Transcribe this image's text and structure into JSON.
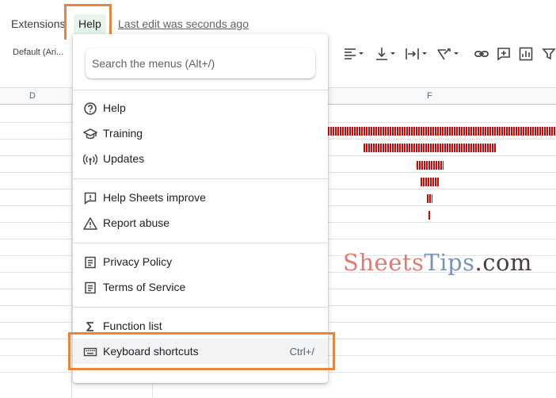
{
  "menubar": {
    "extensions_label": "Extensions",
    "help_label": "Help",
    "last_edit": "Last edit was seconds ago"
  },
  "toolbar": {
    "font_value": "Default (Ari...",
    "icons": [
      "align-left-icon",
      "valign-bottom-icon",
      "text-wrap-icon",
      "text-rotate-icon",
      "link-icon",
      "comment-icon",
      "chart-icon",
      "filter-icon"
    ]
  },
  "grid": {
    "columns": [
      "D",
      "F"
    ]
  },
  "help_menu": {
    "search_placeholder": "Search the menus (Alt+/)",
    "items": [
      {
        "label": "Help",
        "icon": "help-circle-icon"
      },
      {
        "label": "Training",
        "icon": "graduation-cap-icon"
      },
      {
        "label": "Updates",
        "icon": "broadcast-icon"
      },
      {
        "label": "Help Sheets improve",
        "icon": "feedback-icon"
      },
      {
        "label": "Report abuse",
        "icon": "warning-triangle-icon"
      },
      {
        "label": "Privacy Policy",
        "icon": "document-icon"
      },
      {
        "label": "Terms of Service",
        "icon": "document-icon"
      },
      {
        "label": "Function list",
        "icon": "sigma-icon"
      },
      {
        "label": "Keyboard shortcuts",
        "icon": "keyboard-icon",
        "shortcut": "Ctrl+/"
      }
    ]
  },
  "watermark": {
    "part1": "Sheets",
    "part2": "Tips",
    "part3": ".com"
  },
  "colors": {
    "highlight": "#e8853a",
    "spark": "#e00000",
    "help_active_bg": "#e6f4ea"
  }
}
